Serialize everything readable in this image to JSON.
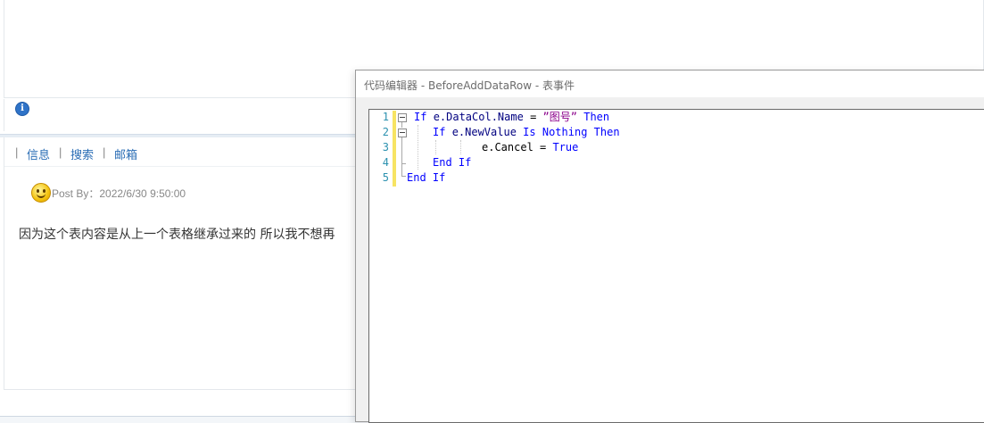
{
  "forum": {
    "info_icon": "info-circle-icon",
    "user_links": {
      "separator": "|",
      "items": [
        "信息",
        "搜索",
        "邮箱"
      ]
    },
    "post": {
      "avatar_icon": "smiley-icon",
      "post_by": "Post By：2022/6/30 9:50:00",
      "text": "因为这个表内容是从上一个表格继承过来的   所以我不想再"
    }
  },
  "editor": {
    "title": "代码编辑器 - BeforeAddDataRow - 表事件",
    "line_numbers": [
      "1",
      "2",
      "3",
      "4",
      "5"
    ],
    "code": {
      "l1": {
        "kw1": "If",
        "id1": "e.DataCol.Name",
        "op": " = ",
        "str": "”图号”",
        "kw2": "Then"
      },
      "l2": {
        "kw1": "If",
        "id1": "e.NewValue",
        "kw2": "Is",
        "kw3": "Nothing",
        "kw4": "Then"
      },
      "l3": {
        "id1": "e.Cancel",
        "op": " = ",
        "kw1": "True"
      },
      "l4": {
        "kw1": "End",
        "kw2": "If"
      },
      "l5": {
        "kw1": "End",
        "kw2": "If"
      }
    },
    "colors": {
      "keyword": "#0000ff",
      "identifier": "#000080",
      "string": "#8b008b",
      "line_number": "#2b91af",
      "change_marker": "#f7e463"
    }
  }
}
